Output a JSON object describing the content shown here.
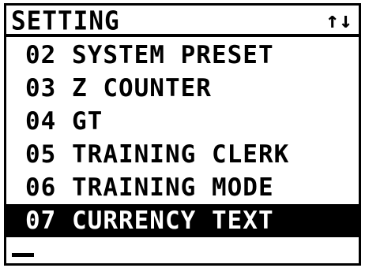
{
  "header": {
    "title": "SETTING",
    "scroll_indicator": "↑↓"
  },
  "menu": {
    "items": [
      {
        "label": "02 SYSTEM PRESET",
        "selected": false
      },
      {
        "label": "03 Z COUNTER",
        "selected": false
      },
      {
        "label": "04 GT",
        "selected": false
      },
      {
        "label": "05 TRAINING CLERK",
        "selected": false
      },
      {
        "label": "06 TRAINING MODE",
        "selected": false
      },
      {
        "label": "07 CURRENCY TEXT",
        "selected": true
      }
    ]
  },
  "colors": {
    "background": "#ffffff",
    "foreground": "#000000",
    "selected_background": "#000000",
    "selected_foreground": "#ffffff"
  }
}
